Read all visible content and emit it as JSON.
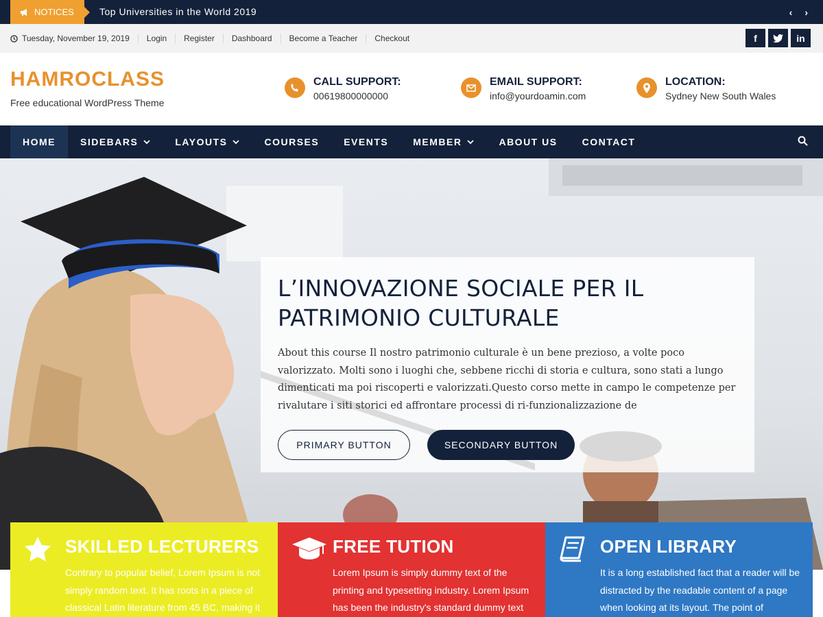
{
  "notice": {
    "label": "NOTICES",
    "text": "Top Universities in the World 2019",
    "prev_glyph": "‹",
    "next_glyph": "›"
  },
  "topbar": {
    "date": "Tuesday, November 19, 2019",
    "links": [
      "Login",
      "Register",
      "Dashboard",
      "Become a Teacher",
      "Checkout"
    ],
    "social": [
      {
        "name": "facebook-icon",
        "glyph": "f"
      },
      {
        "name": "twitter-icon",
        "glyph": "t"
      },
      {
        "name": "linkedin-icon",
        "glyph": "in"
      }
    ]
  },
  "header": {
    "logo": "HAMROCLASS",
    "tagline": "Free educational WordPress Theme",
    "contacts": [
      {
        "title": "CALL SUPPORT:",
        "value": "00619800000000",
        "icon": "phone-icon"
      },
      {
        "title": "EMAIL SUPPORT:",
        "value": "info@yourdoamin.com",
        "icon": "envelope-icon"
      },
      {
        "title": "LOCATION:",
        "value": "Sydney New South Wales",
        "icon": "map-pin-icon"
      }
    ]
  },
  "nav": {
    "items": [
      {
        "label": "HOME",
        "dropdown": false
      },
      {
        "label": "SIDEBARS",
        "dropdown": true
      },
      {
        "label": "LAYOUTS",
        "dropdown": true
      },
      {
        "label": "COURSES",
        "dropdown": false
      },
      {
        "label": "EVENTS",
        "dropdown": false
      },
      {
        "label": "MEMBER",
        "dropdown": true
      },
      {
        "label": "ABOUT US",
        "dropdown": false
      },
      {
        "label": "CONTACT",
        "dropdown": false
      }
    ],
    "active": "HOME"
  },
  "hero": {
    "title": "L’INNOVAZIONE SOCIALE PER IL PATRIMONIO CULTURALE",
    "description": "About this course Il nostro patrimonio culturale è un bene prezioso, a volte poco valorizzato. Molti sono i luoghi che, sebbene ricchi di storia e cultura, sono stati a lungo dimenticati ma poi riscoperti e valorizzati.Questo corso mette in campo le competenze per rivalutare i siti storici ed affrontare processi di ri-funzionalizzazione de",
    "primary_button": "PRIMARY BUTTON",
    "secondary_button": "SECONDARY BUTTON"
  },
  "features": [
    {
      "title": "SKILLED LECTURERS",
      "text": "Contrary to popular belief, Lorem Ipsum is not simply random text. It has roots in a piece of classical Latin literature from 45 BC, making it",
      "icon": "star-icon",
      "color": "#ecec24"
    },
    {
      "title": "FREE TUTION",
      "text": "Lorem Ipsum is simply dummy text of the printing and typesetting industry. Lorem Ipsum has been the industry's standard dummy text",
      "icon": "graduation-cap-icon",
      "color": "#e23232"
    },
    {
      "title": "OPEN LIBRARY",
      "text": "It is a long established fact that a reader will be distracted by the readable content of a page when looking at its layout. The point of",
      "icon": "book-icon",
      "color": "#2f78c4"
    }
  ],
  "colors": {
    "navy": "#13213a",
    "accent": "#e8912c"
  }
}
